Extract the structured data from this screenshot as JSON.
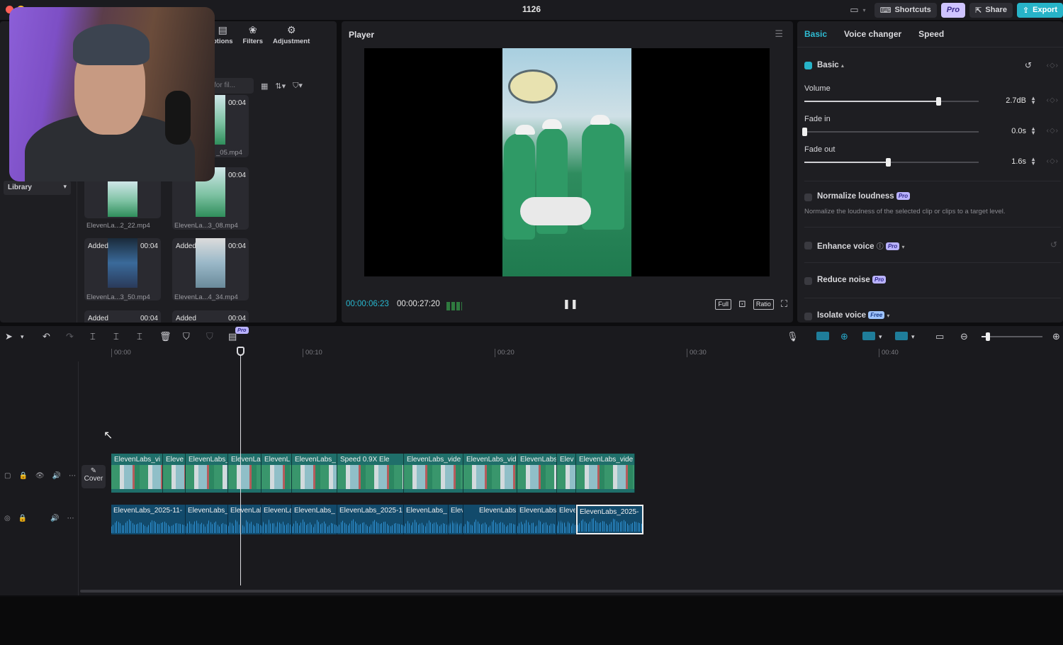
{
  "window": {
    "title": "1126"
  },
  "topbar": {
    "shortcuts_label": "Shortcuts",
    "pro_label": "Pro",
    "share_label": "Share",
    "export_label": "Export"
  },
  "media_panel": {
    "tabs": [
      {
        "label": "ptions",
        "icon": "captions-icon"
      },
      {
        "label": "Filters",
        "icon": "filters-icon"
      },
      {
        "label": "Adjustment",
        "icon": "adjustment-icon"
      }
    ],
    "search_placeholder": "for fil...",
    "library_label": "Library",
    "clips": [
      {
        "duration": "00:04",
        "name": "_05.mp4",
        "added": ""
      },
      {
        "duration": "00:04",
        "name": "",
        "added": ""
      },
      {
        "duration": "",
        "name": "ElevenLa...2_22.mp4",
        "added": ""
      },
      {
        "duration": "",
        "name": "ElevenLa...3_08.mp4",
        "added": ""
      },
      {
        "duration": "00:04",
        "name": "ElevenLa...3_50.mp4",
        "added": "Added"
      },
      {
        "duration": "00:04",
        "name": "ElevenLa...4_34.mp4",
        "added": "Added"
      },
      {
        "duration": "00:04",
        "name": "",
        "added": "Added"
      },
      {
        "duration": "00:04",
        "name": "",
        "added": "Added"
      }
    ]
  },
  "player": {
    "title": "Player",
    "current_time": "00:00:06:23",
    "total_time": "00:00:27:20",
    "full_label": "Full",
    "ratio_label": "Ratio"
  },
  "right_panel": {
    "tabs": [
      "Basic",
      "Voice changer",
      "Speed"
    ],
    "section_title": "Basic",
    "volume": {
      "label": "Volume",
      "value": "2.7dB",
      "level": 0.77
    },
    "fade_in": {
      "label": "Fade in",
      "value": "0.0s",
      "level": 0.0
    },
    "fade_out": {
      "label": "Fade out",
      "value": "1.6s",
      "level": 0.48
    },
    "normalize": {
      "label": "Normalize loudness",
      "badge": "Pro",
      "desc": "Normalize the loudness of the selected clip or clips to a target level."
    },
    "enhance": {
      "label": "Enhance voice",
      "badge": "Pro"
    },
    "reduce": {
      "label": "Reduce noise",
      "badge": "Pro"
    },
    "isolate": {
      "label": "Isolate voice",
      "badge": "Free"
    }
  },
  "timeline": {
    "toolbar_pro_badge": "Pro",
    "ruler": [
      "00:00",
      "00:10",
      "00:20",
      "00:30",
      "00:40"
    ],
    "cover_label": "Cover",
    "video_clips": [
      "ElevenLabs_vi",
      "Eleve",
      "ElevenLabs_",
      "ElevenLa",
      "ElevenL",
      "ElevenLabs_",
      "Speed 0.9X  Ele",
      "ElevenLabs_vide",
      "ElevenLabs_vid",
      "ElevenLabs",
      "Elev",
      "ElevenLabs_vide"
    ],
    "audio_clips": [
      "ElevenLabs_2025-11-",
      "ElevenLabs_",
      "ElevenLal",
      "ElevenLa",
      "ElevenLabs_",
      "ElevenLabs_2025-1",
      "ElevenLabs_",
      "Elev",
      "ElevenLabs",
      "ElevenLabs",
      "Eleve",
      "ElevenLabs_2025-"
    ]
  }
}
